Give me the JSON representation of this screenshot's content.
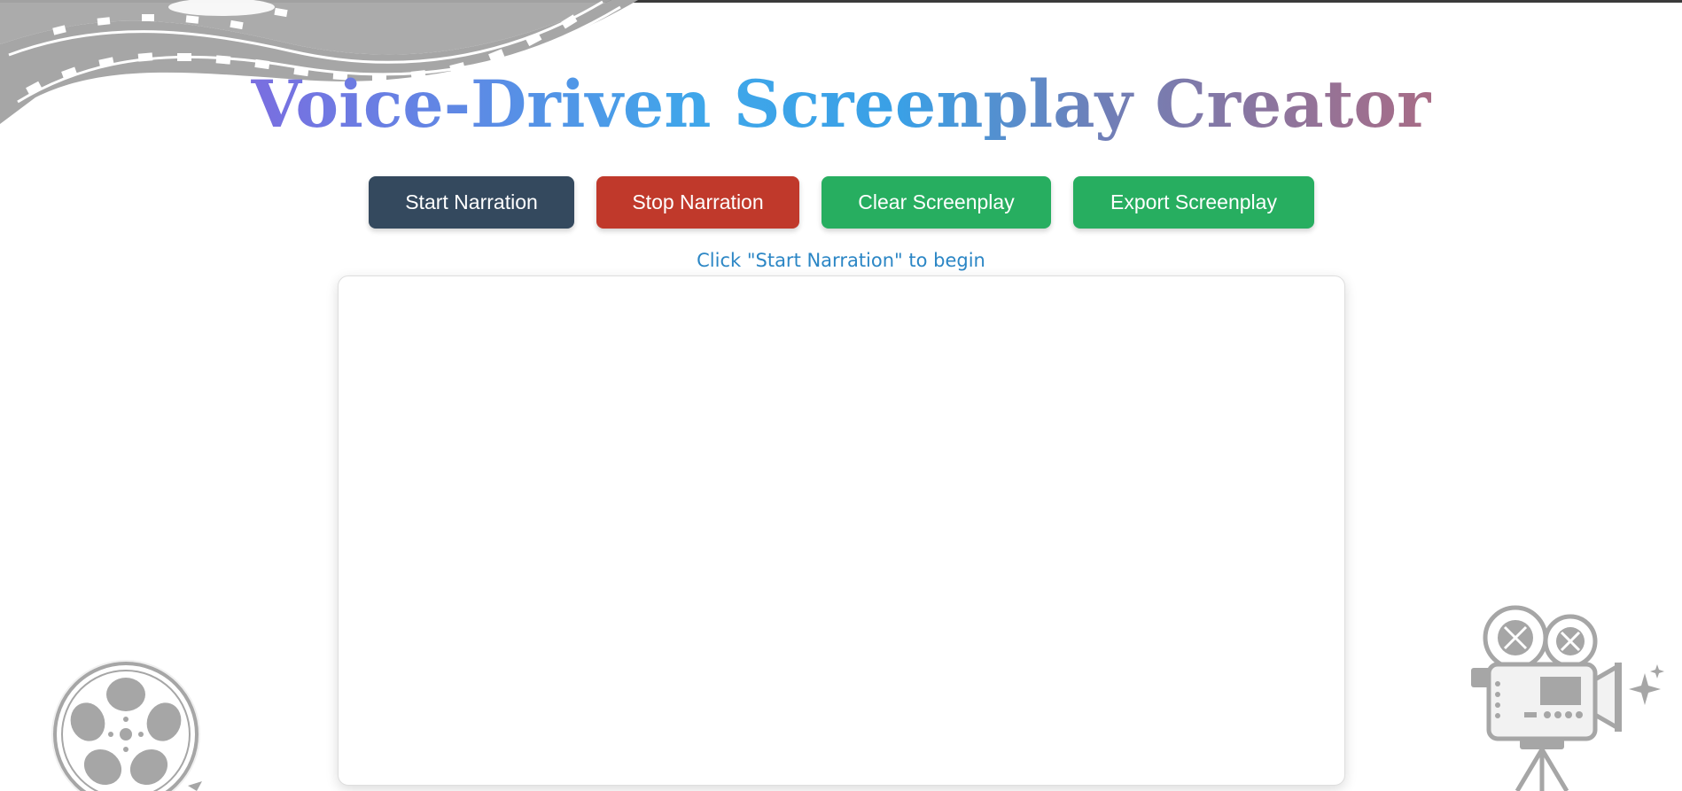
{
  "app": {
    "title": "Voice-Driven Screenplay Creator"
  },
  "toolbar": {
    "start_label": "Start Narration",
    "stop_label": "Stop Narration",
    "clear_label": "Clear Screenplay",
    "export_label": "Export Screenplay"
  },
  "status": {
    "text": "Click \"Start Narration\" to begin"
  },
  "editor": {
    "value": ""
  },
  "colors": {
    "start_button": "#34495e",
    "stop_button": "#c0392b",
    "clear_button": "#27ae60",
    "export_button": "#27ae60",
    "status_text": "#2b86c5",
    "decor_gray": "#a6a6a6"
  },
  "icons": {
    "top_left": "film-strip-icon",
    "bottom_left": "film-reel-icon",
    "bottom_right": "movie-camera-icon"
  }
}
